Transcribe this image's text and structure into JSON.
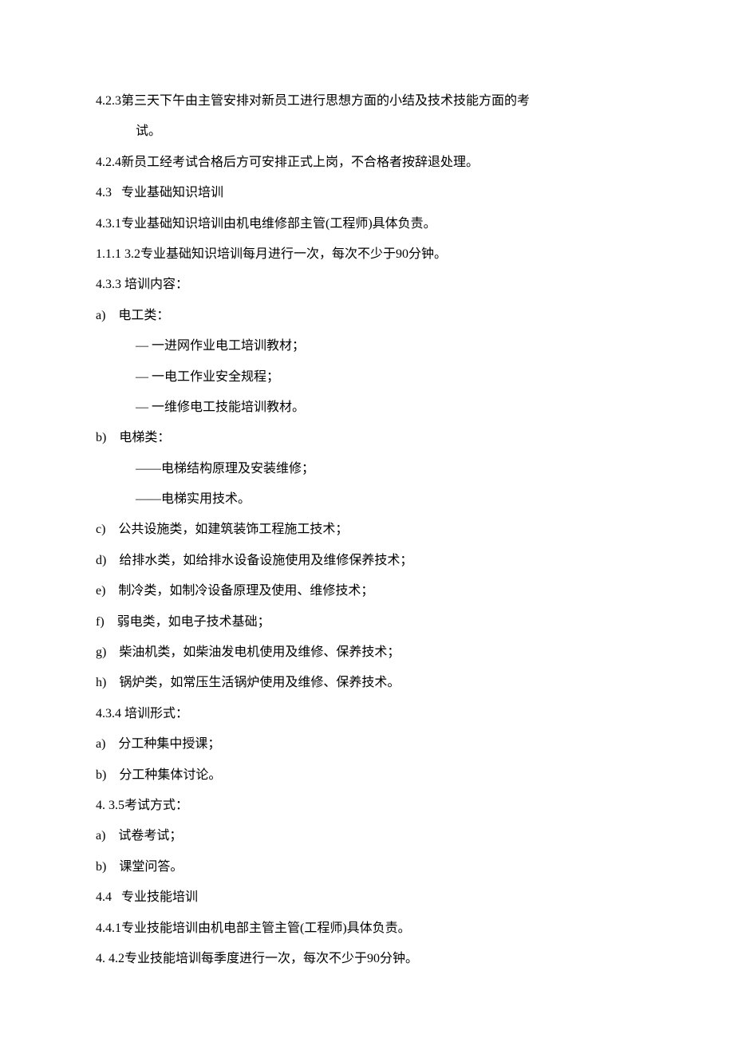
{
  "p423_num": "4.2.3",
  "p423_line1": "第三天下午由主管安排对新员工进行思想方面的小结及技术技能方面的考",
  "p423_line2": "试。",
  "p424": "4.2.4新员工经考试合格后方可安排正式上岗，不合格者按辞退处理。",
  "p43": "4.3   专业基础知识培训",
  "p431": "4.3.1专业基础知识培训由机电维修部主管(工程师)具体负责。",
  "p111_32": "1.1.1 3.2专业基础知识培训每月进行一次，每次不少于90分钟。",
  "p433": "4.3.3 培训内容：",
  "a": "a)    电工类：",
  "a1": "— 一进网作业电工培训教材；",
  "a2": "— 一电工作业安全规程；",
  "a3": "— 一维修电工技能培训教材。",
  "b": "b)    电梯类：",
  "b1": "——电梯结构原理及安装维修；",
  "b2": "——电梯实用技术。",
  "c": "c)    公共设施类，如建筑装饰工程施工技术；",
  "d": "d)    给排水类，如给排水设备设施使用及维修保养技术；",
  "e": "e)    制冷类，如制冷设备原理及使用、维修技术；",
  "f": "f)    弱电类，如电子技术基础；",
  "g": "g)    柴油机类，如柴油发电机使用及维修、保养技术；",
  "h": "h)    锅炉类，如常压生活锅炉使用及维修、保养技术。",
  "p434": "4.3.4 培训形式：",
  "p434a": "a)    分工种集中授课；",
  "p434b": "b)    分工种集体讨论。",
  "p435": "4. 3.5考试方式：",
  "p435a": "a)    试卷考试；",
  "p435b": "b)    课堂问答。",
  "p44": "4.4   专业技能培训",
  "p441": "4.4.1专业技能培训由机电部主管主管(工程师)具体负责。",
  "p442": "4. 4.2专业技能培训每季度进行一次，每次不少于90分钟。"
}
